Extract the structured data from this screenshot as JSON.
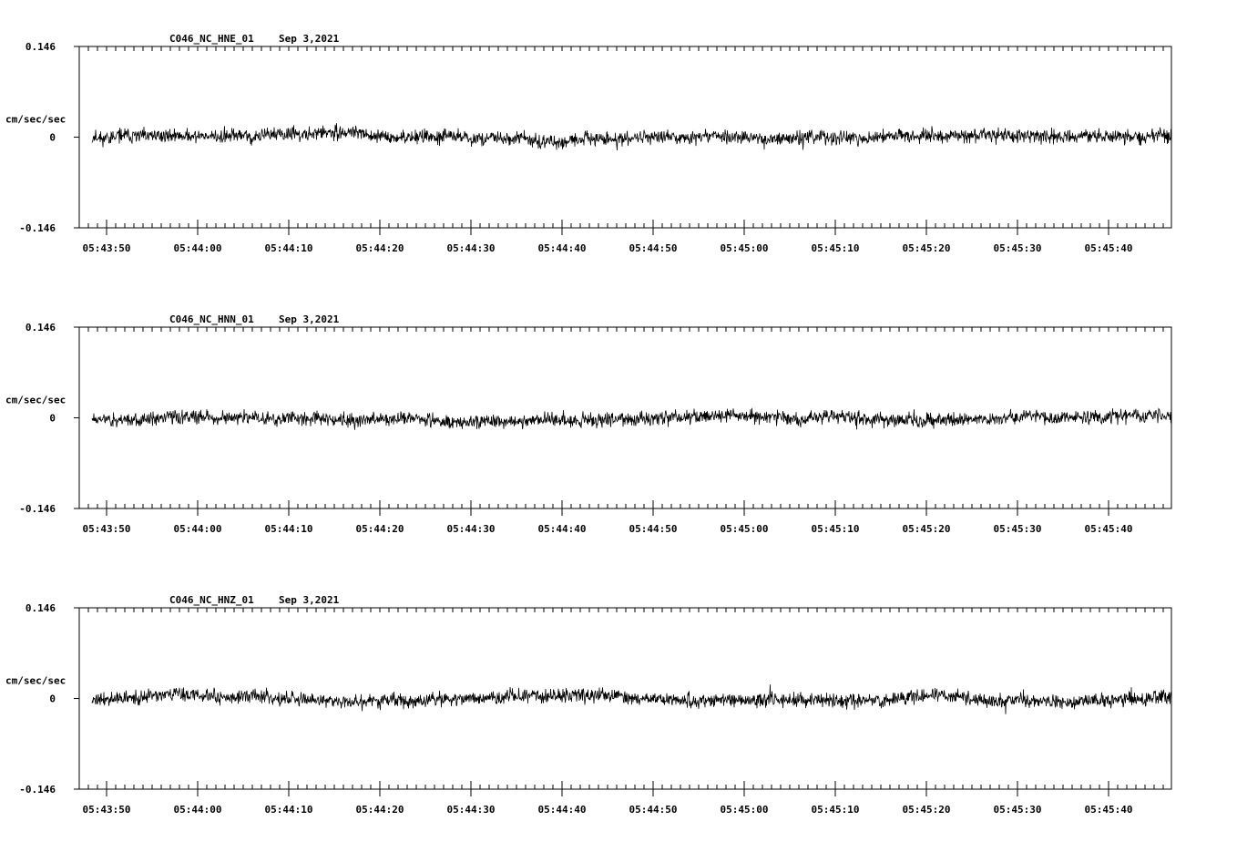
{
  "chart_data": [
    {
      "type": "line",
      "title": "C046_NC_HNE_01",
      "date": "Sep 3,2021",
      "ylabel": "cm/sec/sec",
      "ylim": [
        -0.146,
        0.146
      ],
      "yticks": [
        "0.146",
        "0",
        "-0.146"
      ],
      "xticks": [
        "05:43:50",
        "05:44:00",
        "05:44:10",
        "05:44:20",
        "05:44:30",
        "05:44:40",
        "05:44:50",
        "05:45:00",
        "05:45:10",
        "05:45:20",
        "05:45:30",
        "05:45:40"
      ],
      "series": [
        {
          "amplitude": 0.02,
          "seed": 11
        }
      ]
    },
    {
      "type": "line",
      "title": "C046_NC_HNN_01",
      "date": "Sep 3,2021",
      "ylabel": "cm/sec/sec",
      "ylim": [
        -0.146,
        0.146
      ],
      "yticks": [
        "0.146",
        "0",
        "-0.146"
      ],
      "xticks": [
        "05:43:50",
        "05:44:00",
        "05:44:10",
        "05:44:20",
        "05:44:30",
        "05:44:40",
        "05:44:50",
        "05:45:00",
        "05:45:10",
        "05:45:20",
        "05:45:30",
        "05:45:40"
      ],
      "series": [
        {
          "amplitude": 0.02,
          "seed": 23
        }
      ]
    },
    {
      "type": "line",
      "title": "C046_NC_HNZ_01",
      "date": "Sep 3,2021",
      "ylabel": "cm/sec/sec",
      "ylim": [
        -0.146,
        0.146
      ],
      "yticks": [
        "0.146",
        "0",
        "-0.146"
      ],
      "xticks": [
        "05:43:50",
        "05:44:00",
        "05:44:10",
        "05:44:20",
        "05:44:30",
        "05:44:40",
        "05:44:50",
        "05:45:00",
        "05:45:10",
        "05:45:20",
        "05:45:30",
        "05:45:40"
      ],
      "series": [
        {
          "amplitude": 0.02,
          "seed": 37
        }
      ]
    }
  ]
}
